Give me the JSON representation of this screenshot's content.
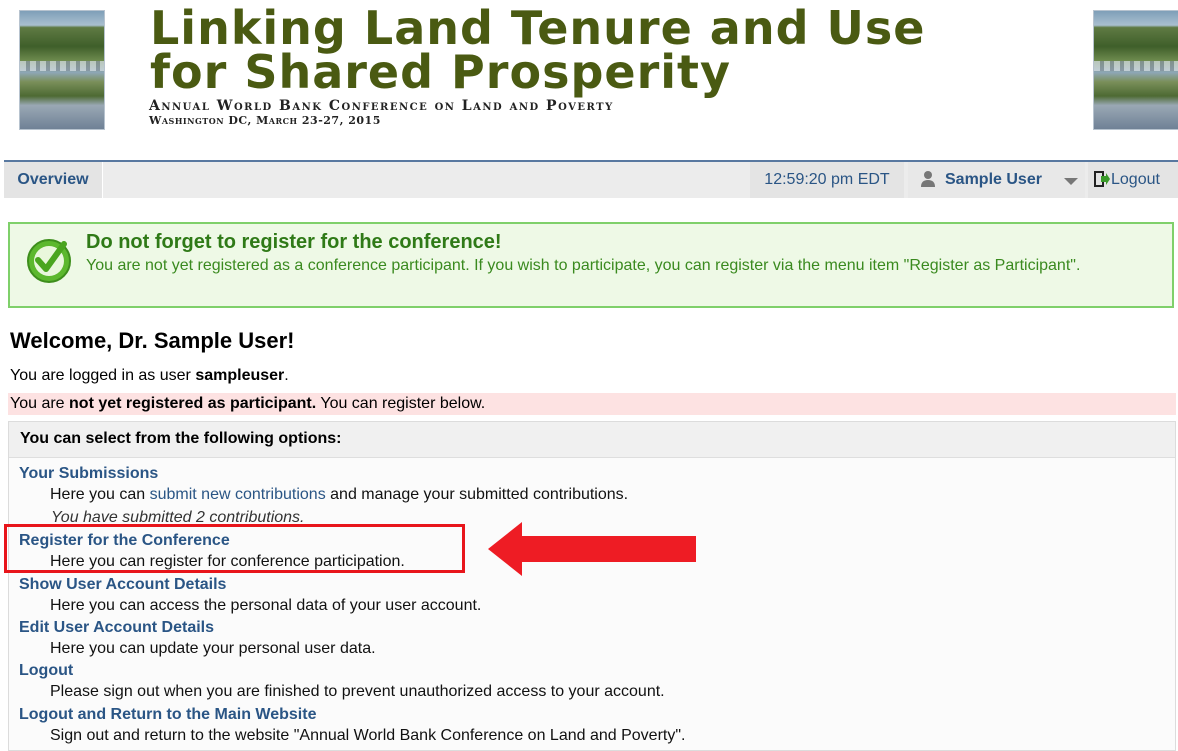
{
  "banner": {
    "title_line1": "Linking Land Tenure and Use",
    "title_line2": "for Shared Prosperity",
    "subtitle": "Annual World Bank Conference on Land and Poverty",
    "dates": "Washington DC, March 23-27, 2015"
  },
  "nav": {
    "overview": "Overview",
    "time": "12:59:20 pm EDT",
    "user": "Sample User",
    "logout": "Logout"
  },
  "notice": {
    "title": "Do not forget to register for the conference!",
    "body": "You are not yet registered as a conference participant. If you wish to participate, you can register via the menu item \"Register as Participant\"."
  },
  "welcome": {
    "heading": "Welcome, Dr. Sample User!",
    "logged_in_prefix": "You are logged in as user ",
    "username": "sampleuser",
    "logged_in_suffix": ".",
    "warning_prefix": "You are ",
    "warning_bold": "not yet registered as participant.",
    "warning_suffix": " You can register below."
  },
  "options": {
    "header": "You can select from the following options:",
    "items": [
      {
        "title": "Your Submissions",
        "desc_prefix": "Here you can ",
        "desc_link": "submit new contributions",
        "desc_suffix": " and manage your submitted contributions.",
        "note": "You have submitted 2 contributions."
      },
      {
        "title": "Register for the Conference",
        "desc": "Here you can register for conference participation."
      },
      {
        "title": "Show User Account Details",
        "desc": "Here you can access the personal data of your user account."
      },
      {
        "title": "Edit User Account Details",
        "desc": "Here you can update your personal user data."
      },
      {
        "title": "Logout",
        "desc": "Please sign out when you are finished to prevent unauthorized access to your account."
      },
      {
        "title": "Logout and Return to the Main Website",
        "desc": "Sign out and return to the website \"Annual World Bank Conference on Land and Poverty\"."
      }
    ]
  },
  "colors": {
    "title_green": "#4a5a12",
    "link_blue": "#2a5585",
    "notice_green": "#2f7a17",
    "highlight_red": "#e8151b"
  }
}
